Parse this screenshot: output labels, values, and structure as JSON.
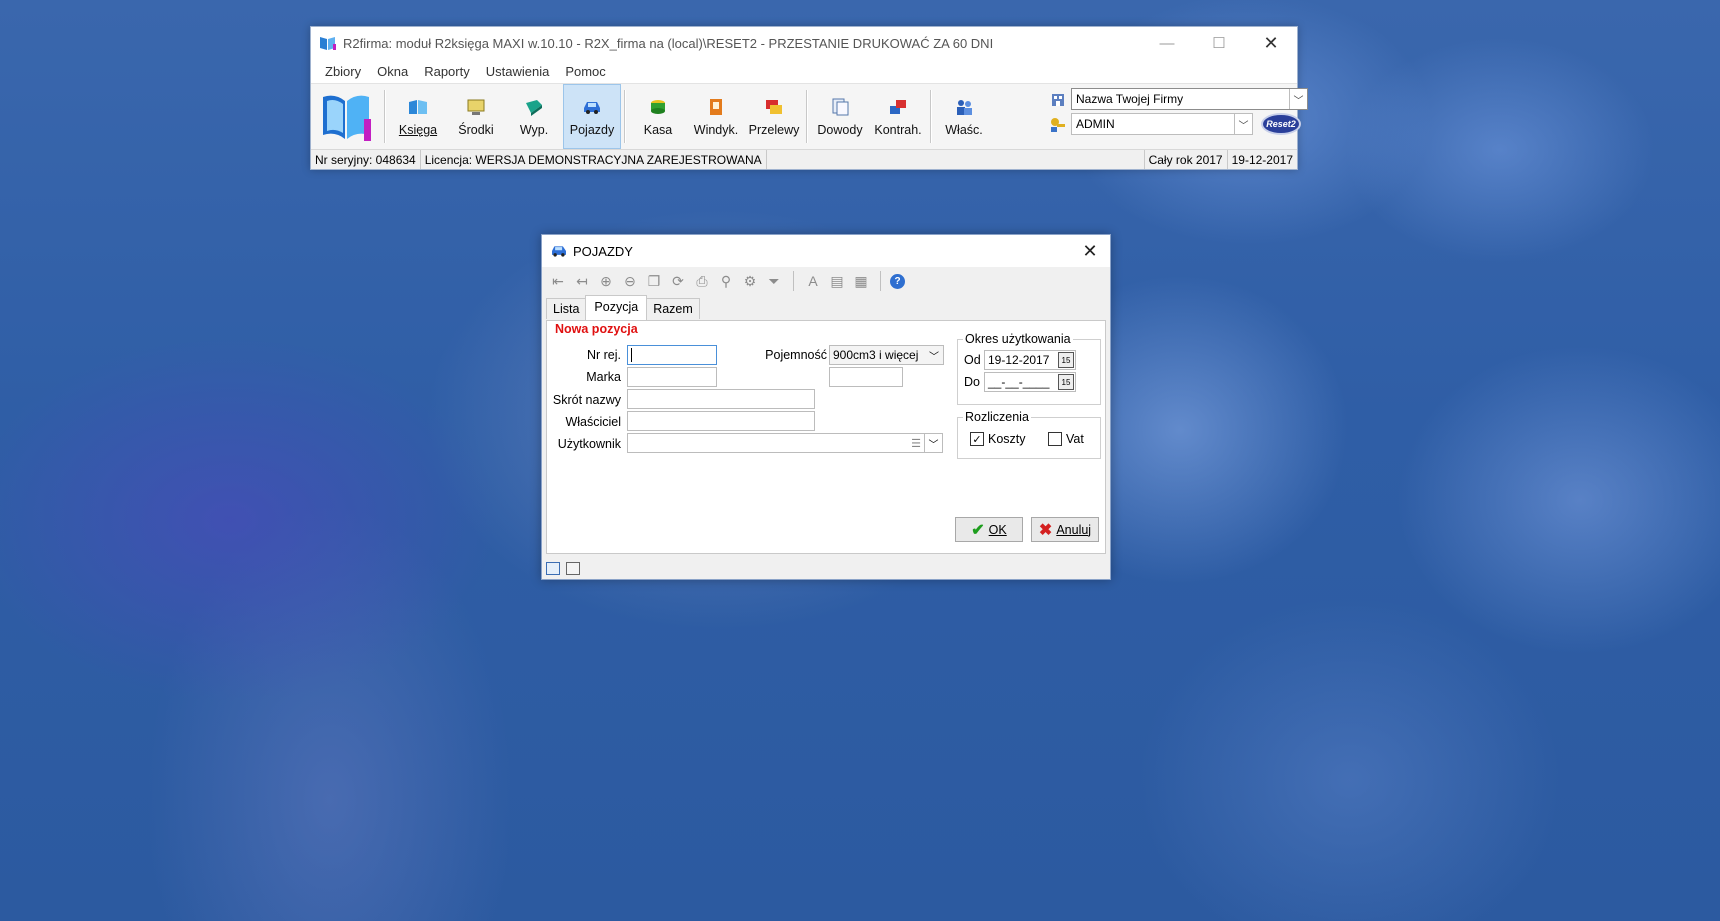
{
  "main_window": {
    "title": "R2firma: moduł R2księga MAXI w.10.10 - R2X_firma na (local)\\RESET2 - PRZESTANIE DRUKOWAĆ ZA 60 DNI",
    "menu": [
      "Zbiory",
      "Okna",
      "Raporty",
      "Ustawienia",
      "Pomoc"
    ],
    "toolbar": {
      "ksiega": "Księga",
      "srodki": "Środki",
      "wyp": "Wyp.",
      "pojazdy": "Pojazdy",
      "kasa": "Kasa",
      "windyk": "Windyk.",
      "przelewy": "Przelewy",
      "dowody": "Dowody",
      "kontrah": "Kontrah.",
      "wlasc": "Właśc."
    },
    "firm_combo": "Nazwa Twojej Firmy",
    "user_combo": "ADMIN",
    "brand_badge": "Reset2",
    "status": {
      "serial": "Nr seryjny: 048634",
      "license": "Licencja: WERSJA DEMONSTRACYJNA ZAREJESTROWANA",
      "period": "Cały rok 2017",
      "date": "19-12-2017"
    }
  },
  "dialog": {
    "title": "POJAZDY",
    "tabs": [
      "Lista",
      "Pozycja",
      "Razem"
    ],
    "section_title": "Nowa pozycja",
    "labels": {
      "nr_rej": "Nr rej.",
      "marka": "Marka",
      "skrot": "Skrót nazwy",
      "wlasciciel": "Właściciel",
      "uzytkownik": "Użytkownik",
      "pojemnosc": "Pojemność"
    },
    "values": {
      "nr_rej": "",
      "marka": "",
      "skrot": "",
      "wlasciciel": "",
      "uzytkownik": "",
      "pojemnosc": "900cm3 i więcej",
      "pojemnosc_extra": ""
    },
    "okres": {
      "title": "Okres użytkowania",
      "od_label": "Od",
      "od_value": "19-12-2017",
      "do_label": "Do",
      "do_value": "__-__-____",
      "cal_label": "15"
    },
    "rozliczenia": {
      "title": "Rozliczenia",
      "koszty": "Koszty",
      "koszty_checked": true,
      "vat": "Vat",
      "vat_checked": false
    },
    "buttons": {
      "ok": "OK",
      "anuluj": "Anuluj"
    }
  },
  "colors": {
    "accent": "#cde3f7",
    "section_title": "#e01010",
    "ok_check": "#1e9e1e",
    "cancel_x": "#d42020"
  }
}
